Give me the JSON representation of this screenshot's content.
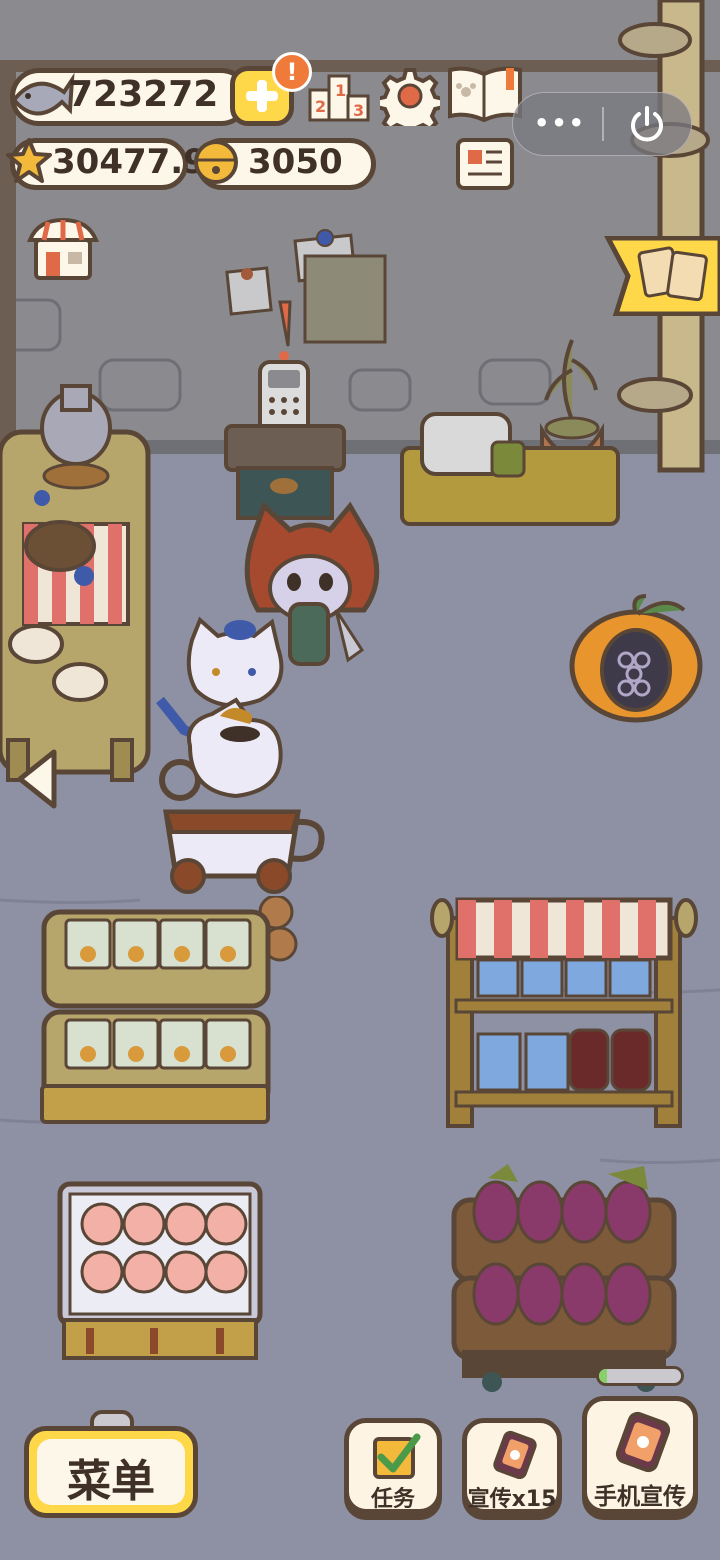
{
  "hud": {
    "fish_count": "723272",
    "star_count": "30477.9",
    "bell_count": "3050",
    "alert_badge": "!"
  },
  "leaderboard": {
    "digits": [
      "2",
      "1",
      "3"
    ]
  },
  "mini_program": {
    "more": "•••"
  },
  "bottom_bar": {
    "menu_label": "菜单",
    "task_label": "任务",
    "promo_label": "宣传x15",
    "phone_promo_label": "手机宣传"
  },
  "colors": {
    "background": "#8e90a3",
    "wall": "#8a8a8f",
    "accent_yellow": "#ffd84a",
    "outline": "#5a4636",
    "badge": "#f07a3a"
  }
}
